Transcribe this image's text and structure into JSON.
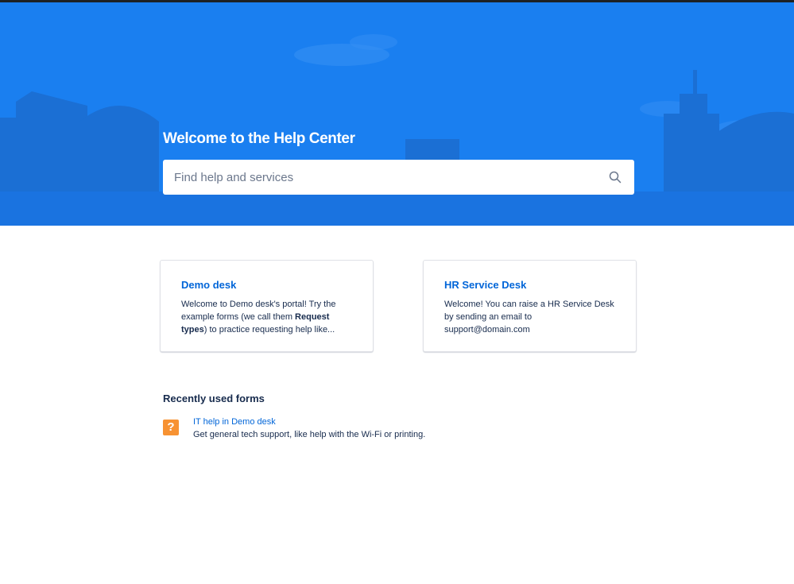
{
  "hero": {
    "title": "Welcome to the Help Center",
    "background_color": "#1a7ff0"
  },
  "search": {
    "placeholder": "Find help and services",
    "value": "",
    "icon": "search-icon"
  },
  "portals": [
    {
      "title": "Demo desk",
      "description_parts": [
        "Welcome to Demo desk's portal! Try the example forms (we call them ",
        "Request types",
        ") to practice requesting help like..."
      ]
    },
    {
      "title": "HR Service Desk",
      "description": "Welcome! You can raise a HR Service Desk by sending an email to support@domain.com"
    }
  ],
  "recent": {
    "heading": "Recently used forms",
    "items": [
      {
        "icon": "question-mark-icon",
        "icon_glyph": "?",
        "icon_color": "#f79232",
        "link": "IT help in Demo desk",
        "description": "Get general tech support, like help with the Wi-Fi or printing."
      }
    ]
  },
  "colors": {
    "link": "#0065d8",
    "text": "#172b4d"
  }
}
